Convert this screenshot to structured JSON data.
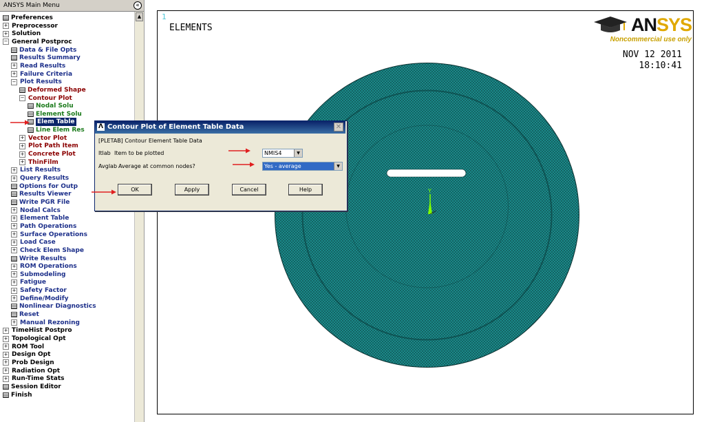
{
  "menu": {
    "title": "ANSYS Main Menu",
    "collapse_glyph": "«",
    "items": [
      {
        "label": "Preferences",
        "icon": "doc",
        "color": "black",
        "indent": 0
      },
      {
        "label": "Preprocessor",
        "icon": "plus",
        "color": "black",
        "indent": 0
      },
      {
        "label": "Solution",
        "icon": "plus",
        "color": "black",
        "indent": 0
      },
      {
        "label": "General Postproc",
        "icon": "minus",
        "color": "black",
        "indent": 0
      },
      {
        "label": "Data & File Opts",
        "icon": "doc",
        "color": "blue",
        "indent": 1
      },
      {
        "label": "Results Summary",
        "icon": "doc",
        "color": "blue",
        "indent": 1
      },
      {
        "label": "Read Results",
        "icon": "plus",
        "color": "blue",
        "indent": 1
      },
      {
        "label": "Failure Criteria",
        "icon": "plus",
        "color": "blue",
        "indent": 1
      },
      {
        "label": "Plot Results",
        "icon": "minus",
        "color": "blue",
        "indent": 1
      },
      {
        "label": "Deformed Shape",
        "icon": "doc",
        "color": "red",
        "indent": 2
      },
      {
        "label": "Contour Plot",
        "icon": "minus",
        "color": "red",
        "indent": 2
      },
      {
        "label": "Nodal Solu",
        "icon": "doc",
        "color": "green",
        "indent": 3
      },
      {
        "label": "Element Solu",
        "icon": "doc",
        "color": "green",
        "indent": 3
      },
      {
        "label": "Elem Table",
        "icon": "doc",
        "color": "green",
        "indent": 3,
        "selected": true
      },
      {
        "label": "Line Elem Res",
        "icon": "doc",
        "color": "green",
        "indent": 3
      },
      {
        "label": "Vector Plot",
        "icon": "plus",
        "color": "red",
        "indent": 2
      },
      {
        "label": "Plot Path Item",
        "icon": "plus",
        "color": "red",
        "indent": 2
      },
      {
        "label": "Concrete Plot",
        "icon": "plus",
        "color": "red",
        "indent": 2
      },
      {
        "label": "ThinFilm",
        "icon": "plus",
        "color": "red",
        "indent": 2
      },
      {
        "label": "List Results",
        "icon": "plus",
        "color": "blue",
        "indent": 1
      },
      {
        "label": "Query Results",
        "icon": "plus",
        "color": "blue",
        "indent": 1
      },
      {
        "label": "Options for Outp",
        "icon": "doc",
        "color": "blue",
        "indent": 1
      },
      {
        "label": "Results Viewer",
        "icon": "doc",
        "color": "blue",
        "indent": 1
      },
      {
        "label": "Write PGR File",
        "icon": "doc",
        "color": "blue",
        "indent": 1
      },
      {
        "label": "Nodal Calcs",
        "icon": "plus",
        "color": "blue",
        "indent": 1
      },
      {
        "label": "Element Table",
        "icon": "plus",
        "color": "blue",
        "indent": 1
      },
      {
        "label": "Path Operations",
        "icon": "plus",
        "color": "blue",
        "indent": 1
      },
      {
        "label": "Surface Operations",
        "icon": "plus",
        "color": "blue",
        "indent": 1
      },
      {
        "label": "Load Case",
        "icon": "plus",
        "color": "blue",
        "indent": 1
      },
      {
        "label": "Check Elem Shape",
        "icon": "plus",
        "color": "blue",
        "indent": 1
      },
      {
        "label": "Write Results",
        "icon": "doc",
        "color": "blue",
        "indent": 1
      },
      {
        "label": "ROM Operations",
        "icon": "plus",
        "color": "blue",
        "indent": 1
      },
      {
        "label": "Submodeling",
        "icon": "plus",
        "color": "blue",
        "indent": 1
      },
      {
        "label": "Fatigue",
        "icon": "plus",
        "color": "blue",
        "indent": 1
      },
      {
        "label": "Safety Factor",
        "icon": "plus",
        "color": "blue",
        "indent": 1
      },
      {
        "label": "Define/Modify",
        "icon": "plus",
        "color": "blue",
        "indent": 1
      },
      {
        "label": "Nonlinear Diagnostics",
        "icon": "doc",
        "color": "blue",
        "indent": 1
      },
      {
        "label": "Reset",
        "icon": "doc",
        "color": "blue",
        "indent": 1
      },
      {
        "label": "Manual Rezoning",
        "icon": "plus",
        "color": "blue",
        "indent": 1
      },
      {
        "label": "TimeHist Postpro",
        "icon": "plus",
        "color": "black",
        "indent": 0
      },
      {
        "label": "Topological Opt",
        "icon": "plus",
        "color": "black",
        "indent": 0
      },
      {
        "label": "ROM Tool",
        "icon": "plus",
        "color": "black",
        "indent": 0
      },
      {
        "label": "Design Opt",
        "icon": "plus",
        "color": "black",
        "indent": 0
      },
      {
        "label": "Prob Design",
        "icon": "plus",
        "color": "black",
        "indent": 0
      },
      {
        "label": "Radiation Opt",
        "icon": "plus",
        "color": "black",
        "indent": 0
      },
      {
        "label": "Run-Time Stats",
        "icon": "plus",
        "color": "black",
        "indent": 0
      },
      {
        "label": "Session Editor",
        "icon": "doc",
        "color": "black",
        "indent": 0
      },
      {
        "label": "Finish",
        "icon": "doc",
        "color": "black",
        "indent": 0
      }
    ]
  },
  "graphics": {
    "window_number": "1",
    "title": "ELEMENTS",
    "date": "NOV 12 2011",
    "time": "18:10:41",
    "logo_an": "AN",
    "logo_sys": "SYS",
    "logo_sub": "Noncommercial use only",
    "mesh_color": "#1a8a8a",
    "axis_label": "Y"
  },
  "dialog": {
    "title": "Contour Plot of Element Table Data",
    "icon_glyph": "Λ",
    "close_glyph": "✕",
    "command": "[PLETAB]  Contour Element Table Data",
    "itlab_key": "Itlab",
    "itlab_desc": "Item to be plotted",
    "itlab_value": "NMIS4",
    "avglab_key": "Avglab",
    "avglab_desc": "Average at common nodes?",
    "avglab_value": "Yes - average",
    "dropdown_glyph": "▼",
    "buttons": {
      "ok": "OK",
      "apply": "Apply",
      "cancel": "Cancel",
      "help": "Help"
    }
  },
  "colors": {
    "annotation_arrow": "#e02020",
    "selection": "#0a246a"
  }
}
